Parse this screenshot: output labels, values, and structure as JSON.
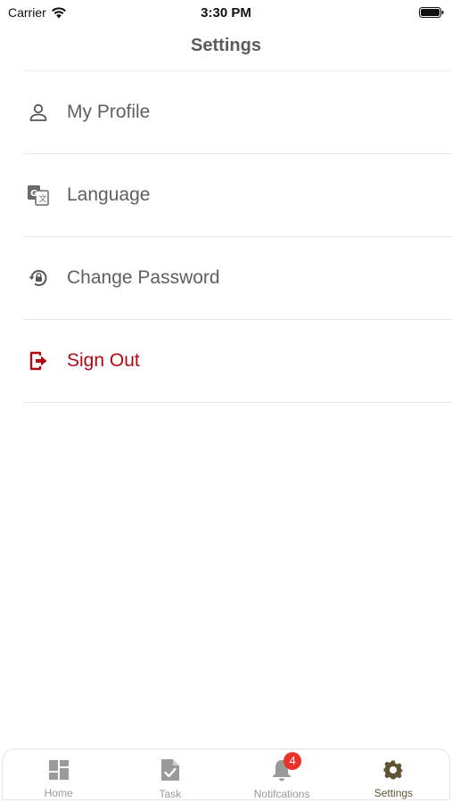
{
  "status_bar": {
    "carrier": "Carrier",
    "time": "3:30 PM"
  },
  "header": {
    "title": "Settings"
  },
  "settings": {
    "items": [
      {
        "label": "My Profile",
        "icon": "person-icon"
      },
      {
        "label": "Language",
        "icon": "translate-icon"
      },
      {
        "label": "Change Password",
        "icon": "lock-reset-icon"
      },
      {
        "label": "Sign Out",
        "icon": "sign-out-icon",
        "color": "#b00a14"
      }
    ]
  },
  "tab_bar": {
    "tabs": [
      {
        "label": "Home",
        "icon": "dashboard-icon"
      },
      {
        "label": "Task",
        "icon": "task-check-icon"
      },
      {
        "label": "Notifcations",
        "icon": "bell-icon",
        "badge": "4"
      },
      {
        "label": "Settings",
        "icon": "gear-icon",
        "active": true
      }
    ]
  },
  "colors": {
    "accent": "#5e5533",
    "danger": "#b00a14",
    "badge": "#e8332a",
    "inactive": "#9a9a9a"
  }
}
